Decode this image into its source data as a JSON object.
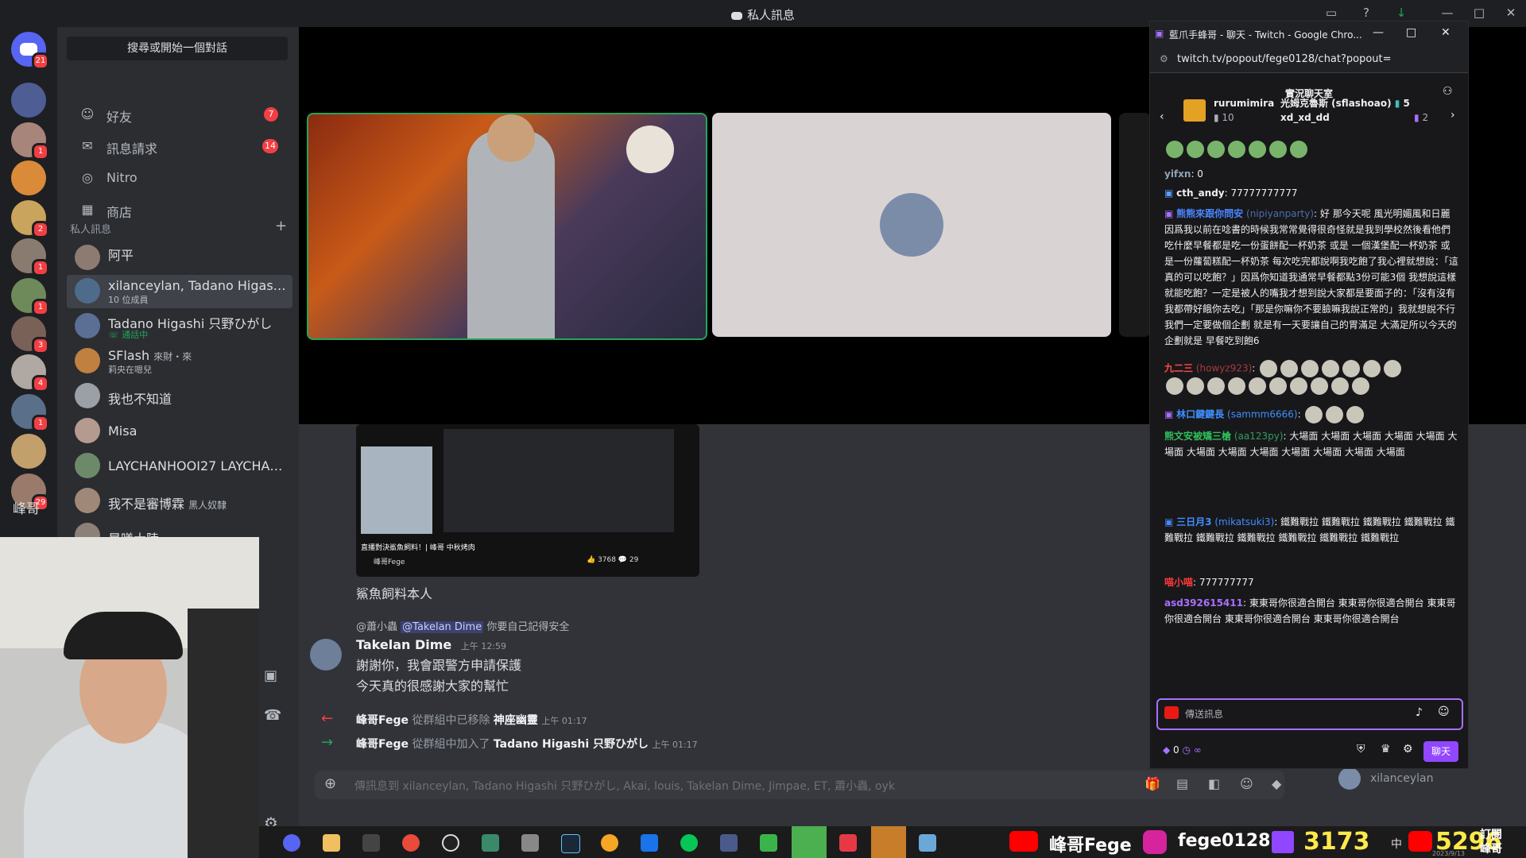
{
  "window": {
    "title": "私人訊息"
  },
  "rail": {
    "badges": [
      "21",
      "1",
      "2",
      "1",
      "1",
      "3",
      "4",
      "1",
      "29"
    ],
    "folder_label": "峰哥"
  },
  "sidebar": {
    "search_placeholder": "搜尋或開始一個對話",
    "nav": [
      {
        "label": "好友",
        "count": "7"
      },
      {
        "label": "訊息請求",
        "count": "14"
      },
      {
        "label": "Nitro"
      },
      {
        "label": "商店"
      }
    ],
    "dm_header": "私人訊息",
    "dms": [
      {
        "name": "阿平"
      },
      {
        "name": "xilanceylan, Tadano Higashi ...",
        "sub": "10 位成員"
      },
      {
        "name": "Tadano Higashi 只野ひがし",
        "sub": "通話中"
      },
      {
        "name": "SFlash",
        "tag": "來財・來",
        "sub": "莉央在嗯兒"
      },
      {
        "name": "我也不知道"
      },
      {
        "name": "Misa"
      },
      {
        "name": "LAYCHANHOOI27 LAYCHANH..."
      },
      {
        "name": "我不是審博霖",
        "tag": "黑人奴隸"
      },
      {
        "name": "晨曦大陸"
      }
    ]
  },
  "preview": {
    "title": "直播對決鯊魚飼料！| 峰哥 中秋烤肉",
    "channel": "峰哥Fege",
    "likes": "3768",
    "comments": "29"
  },
  "chat": {
    "caption": "鯊魚飼料本人",
    "reply_author": "@蕭小蟲",
    "reply_mention": "@Takelan Dime",
    "reply_text": "你要自己記得安全",
    "author": "Takelan Dime",
    "time": "上午 12:59",
    "line1": "謝謝你，我會跟警方申請保護",
    "line2": "今天真的很感謝大家的幫忙",
    "sys1": {
      "who": "峰哥Fege",
      "action": "從群組中已移除",
      "target": "神座幽靈",
      "time": "上午 01:17"
    },
    "sys2": {
      "who": "峰哥Fege",
      "action": "從群組中加入了",
      "target": "Tadano Higashi 只野ひがし",
      "time": "上午 01:17"
    },
    "composer_placeholder": "傳訊息到 xilanceylan, Tadano Higashi 只野ひがし, Akai, louis, Takelan Dime, Jimpae, ET, 蕭小蟲, oyk",
    "voice_user": "xilanceylan"
  },
  "twitch": {
    "window_title": "藍爪手蜂哥 - 聊天 - Twitch - Google Chro...",
    "url": "twitch.tv/popout/fege0128/chat?popout=",
    "header": "實況聊天室",
    "gifters": [
      {
        "name": "rurumimira",
        "count": "10"
      },
      {
        "name": "光姆克魯斯 (sflashoao)",
        "count": "5"
      },
      {
        "name": "xd_xd_dd",
        "count": "2"
      }
    ],
    "messages": [
      {
        "user": "yifxn",
        "text": ": 0"
      },
      {
        "user": "cth_andy",
        "text": ": 77777777777"
      },
      {
        "user": "熊熊來跟你問安",
        "handle": "(nipiyanparty)",
        "text": ": 好 那今天呢 風光明媚風和日麗 因爲我以前在唸書的時候我常常覺得很奇怪就是我到學校然後看他們吃什麼早餐都是吃一份蛋餅配一杯奶茶 或是 一個漢堡配一杯奶茶 或是一份蘿蔔糕配一杯奶茶 每次吃完都說啊我吃飽了我心裡就想說：「這真的可以吃飽？」因爲你知道我通常早餐都點3份可能3個 我想說這樣就能吃飽？一定是被人的嘴我才想到說大家都是要面子的：「沒有沒有 我都帶好餓你去吃」「那是你嘛你不要臉嘛我說正常的」我就想說不行 我們一定要做個企劃 就是有一天要讓自己的胃滿足 大滿足所以今天的企劃就是 早餐吃到飽6"
      },
      {
        "user": "九二三",
        "handle": "(howyz923)",
        "text": ":"
      },
      {
        "user": "林口鍵鍵長",
        "handle": "(sammm6666)",
        "text": ":"
      },
      {
        "user": "熊文安被矯三槍",
        "handle": "(aa123py)",
        "text": ": 大場面 大場面 大場面 大場面 大場面 大場面 大場面 大場面 大場面 大場面 大場面 大場面 大場面"
      },
      {
        "user": "三日月3",
        "handle": "(mikatsuki3)",
        "text": ": 鐵難戰拉 鐵難戰拉 鐵難戰拉 鐵難戰拉 鐵難戰拉 鐵難戰拉 鐵難戰拉 鐵難戰拉 鐵難戰拉 鐵難戰拉"
      },
      {
        "user": "喵小喵",
        "text": ": 777777777"
      },
      {
        "user": "asd392615411",
        "text": ": 東東哥你很適合開台 東東哥你很適合開台 東東哥你很適合開台 東東哥你很適合開台 東東哥你很適合開台"
      }
    ],
    "input_placeholder": "傳送訊息",
    "points": "0",
    "chat_button": "聊天"
  },
  "taskbar": {
    "youtube_label": "峰哥Fege",
    "instagram_label": "fege0128",
    "twitch_count": "3173",
    "youtube_count": "5296",
    "ime": "中",
    "subscribe_1": "訂閱",
    "subscribe_2": "峰哥",
    "date": "2023/9/13"
  },
  "colors": {
    "discord_bg": "#313338",
    "sidebar_bg": "#2b2d31",
    "rail_bg": "#1e1f22",
    "twitch_purple": "#9147ff",
    "badge_red": "#f23f43"
  }
}
